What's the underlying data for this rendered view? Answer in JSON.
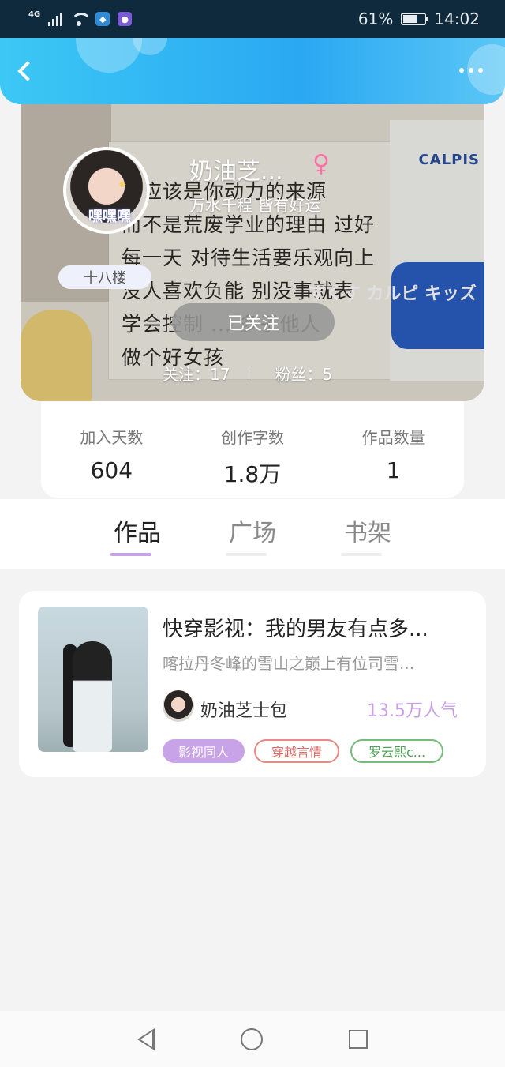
{
  "status_bar": {
    "network": "4G",
    "battery": "61%",
    "time": "14:02"
  },
  "header": {
    "back_icon": "chevron-left-icon",
    "more_icon": "more-dots-icon"
  },
  "banner": {
    "avatar_caption": "嘿嘿嘿",
    "username": "奶油芝...",
    "gender_symbol": "♀",
    "signature": "万水千程 皆有好运",
    "floor_badge": "十八楼",
    "follow_button": "已关注",
    "following_label": "关注：17",
    "followers_label": "粉丝：5",
    "paper_lines": [
      "爱应该是你动力的来源",
      "而不是荒废学业的理由 过好",
      "每一天 对待生活要乐观向上",
      "没人喜欢负能 别没事就表",
      "学会控制 ... 多子他人",
      "做个好女孩"
    ],
    "calpis_word": "CALPIS",
    "calpis_sub": "すくす カルピ キッズ"
  },
  "stats": [
    {
      "label": "加入天数",
      "value": "604"
    },
    {
      "label": "创作字数",
      "value": "1.8万"
    },
    {
      "label": "作品数量",
      "value": "1"
    }
  ],
  "tabs": [
    {
      "label": "作品",
      "active": true
    },
    {
      "label": "广场",
      "active": false
    },
    {
      "label": "书架",
      "active": false
    }
  ],
  "work": {
    "title": "快穿影视：我的男友有点多...",
    "description": "喀拉丹冬峰的雪山之巅上有位司雪...",
    "author": "奶油芝士包",
    "popularity": "13.5万人气",
    "tags": [
      "影视同人",
      "穿越言情",
      "罗云熙c..."
    ]
  },
  "colors": {
    "header_blue": "#2aa8f2",
    "tag_purple": "#c9a3e8",
    "popularity_purple": "#c9a0e6",
    "tag_red": "#e06a63",
    "tag_green": "#4fa456"
  }
}
